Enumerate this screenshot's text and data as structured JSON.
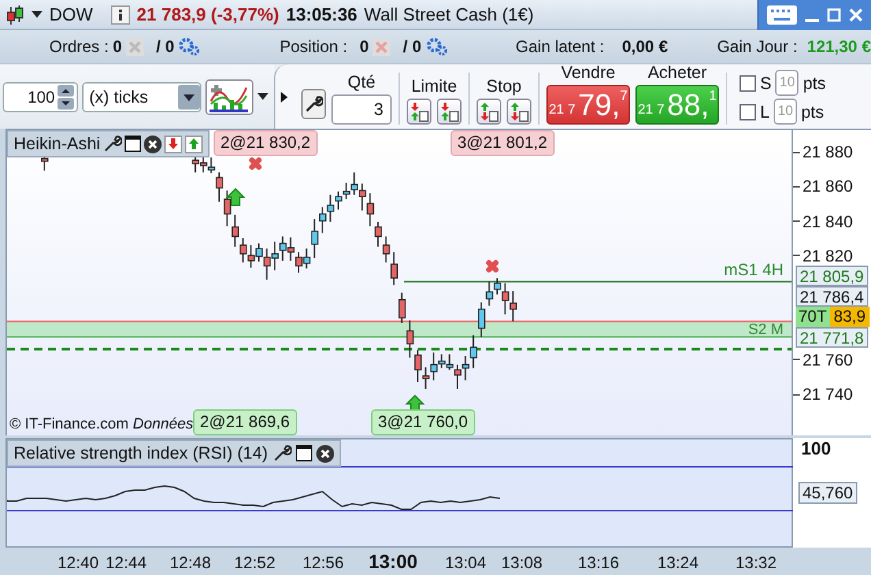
{
  "window": {
    "instrument": "DOW",
    "quote": "21 783,9 (-3,77%)",
    "time": "13:05:36",
    "market": "Wall Street Cash (1€)"
  },
  "info_bar": {
    "orders_label": "Ordres :",
    "orders_count": "0",
    "orders_total": "/ 0",
    "position_label": "Position :",
    "position_count": "0",
    "position_total": "/ 0",
    "unrealized_label": "Gain latent :",
    "unrealized_value": "0,00 €",
    "daily_label": "Gain Jour :",
    "daily_value": "121,30 €"
  },
  "toolbar": {
    "step_value": "100",
    "unit": "(x) ticks",
    "qty_label": "Qté",
    "qty_value": "3",
    "limit_label": "Limite",
    "stop_label": "Stop",
    "sell": {
      "label": "Vendre",
      "prefix": "21 7",
      "big": "79,",
      "small": "7"
    },
    "buy": {
      "label": "Acheter",
      "prefix": "21 7",
      "big": "88,",
      "small": "1"
    },
    "options": [
      {
        "label": "S",
        "checked": false,
        "placeholder": "10",
        "unit": "pts"
      },
      {
        "label": "L",
        "checked": false,
        "placeholder": "10",
        "unit": "pts"
      }
    ]
  },
  "chart": {
    "legend": "Heikin-Ashi",
    "orders": [
      {
        "text": "2@21 830,2",
        "kind": "sell"
      },
      {
        "text": "3@21 801,2",
        "kind": "sell"
      },
      {
        "text": "2@21 869,6",
        "kind": "buy"
      },
      {
        "text": "3@21 760,0",
        "kind": "buy"
      }
    ],
    "level_labels": [
      "mS1 4H",
      "S2 M"
    ],
    "price_ticks": [
      "21 880",
      "21 860",
      "21 840",
      "21 820",
      "21 760",
      "21 740"
    ],
    "price_boxes": [
      "21 805,9",
      "21 786,4",
      "21 771,8"
    ],
    "current": {
      "badge": "70T",
      "price": "83,9"
    },
    "copyright": "© IT-Finance.com",
    "notice": "Données"
  },
  "rsi": {
    "title": "Relative strength index (RSI) (14)",
    "top_label": "100",
    "value": "45,760"
  },
  "time_axis": [
    {
      "label": "12:40",
      "bold": false
    },
    {
      "label": "12:44",
      "bold": false
    },
    {
      "label": "12:48",
      "bold": false
    },
    {
      "label": "12:52",
      "bold": false
    },
    {
      "label": "12:56",
      "bold": false
    },
    {
      "label": "13:00",
      "bold": true
    },
    {
      "label": "13:04",
      "bold": false
    },
    {
      "label": "13:08",
      "bold": false
    },
    {
      "label": "13:16",
      "bold": false
    },
    {
      "label": "13:24",
      "bold": false
    },
    {
      "label": "13:32",
      "bold": false
    }
  ]
}
